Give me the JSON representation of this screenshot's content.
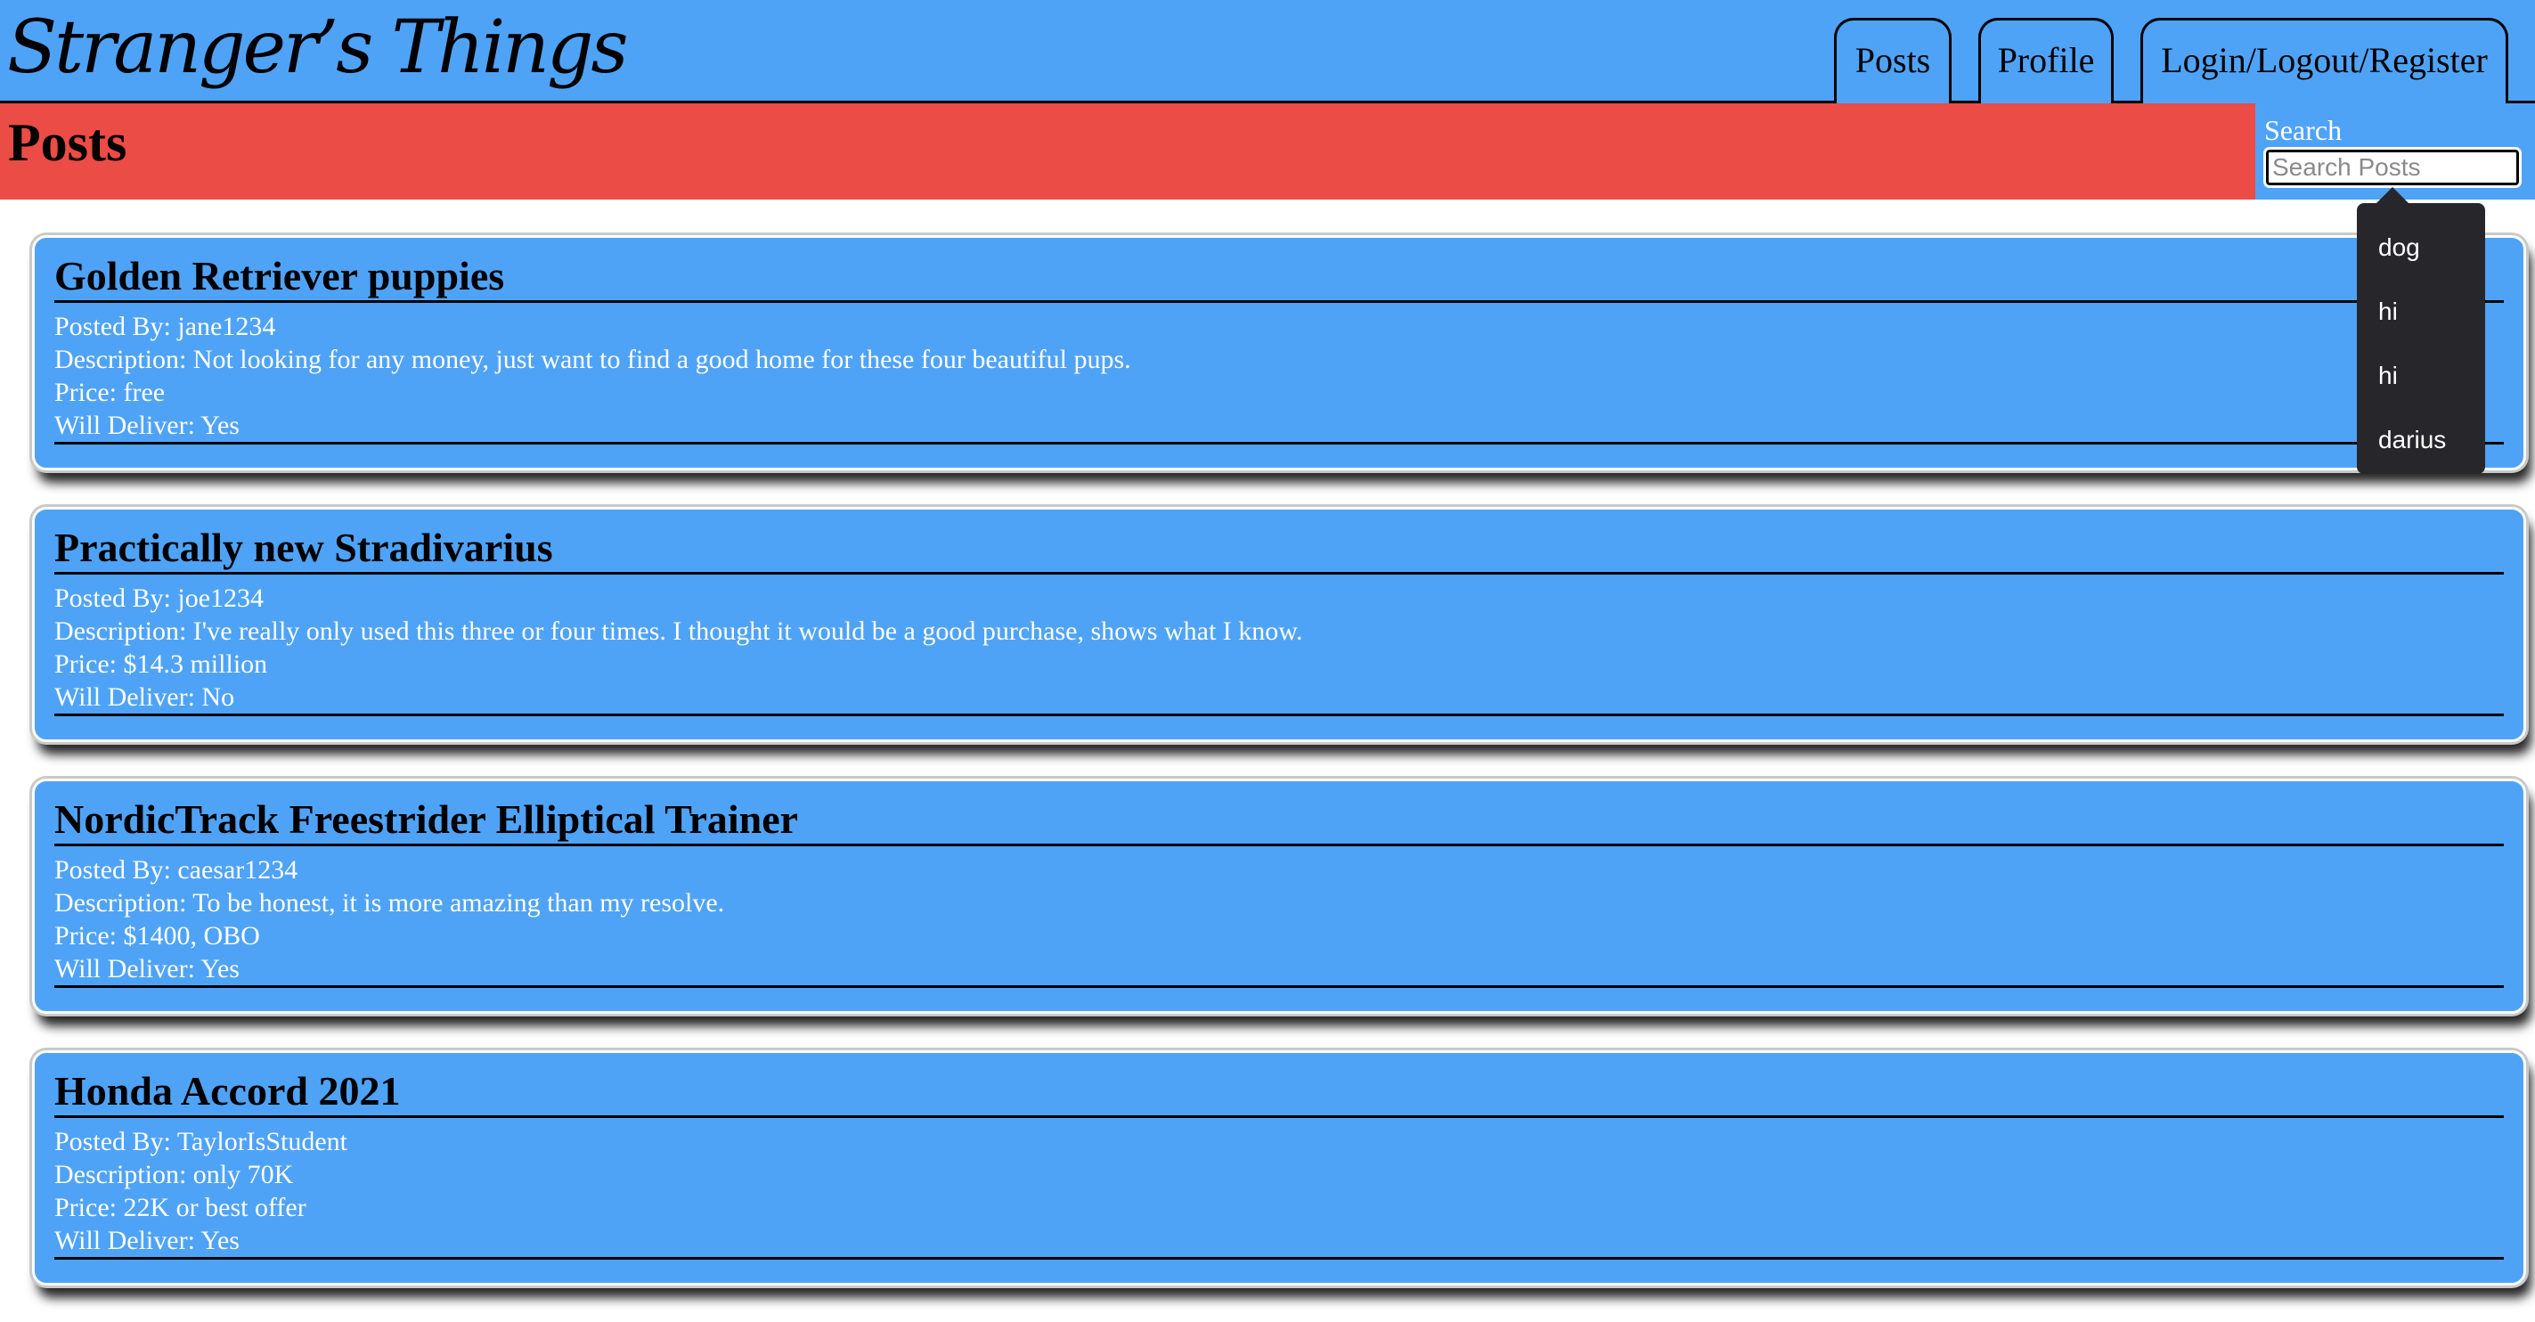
{
  "header": {
    "app_title": "Stranger’s Things",
    "nav": [
      {
        "label": "Posts"
      },
      {
        "label": "Profile"
      },
      {
        "label": "Login/Logout/Register"
      }
    ]
  },
  "page": {
    "title": "Posts"
  },
  "search": {
    "label": "Search",
    "placeholder": "Search Posts",
    "value": "",
    "suggestions": [
      "dog",
      "hi",
      "hi",
      "darius"
    ]
  },
  "posts": [
    {
      "title": "Golden Retriever puppies",
      "posted_by": "Posted By: jane1234",
      "description": "Description: Not looking for any money, just want to find a good home for these four beautiful pups.",
      "price": "Price: free",
      "will_deliver": "Will Deliver: Yes"
    },
    {
      "title": "Practically new Stradivarius",
      "posted_by": "Posted By: joe1234",
      "description": "Description: I've really only used this three or four times. I thought it would be a good purchase, shows what I know.",
      "price": "Price: $14.3 million",
      "will_deliver": "Will Deliver: No"
    },
    {
      "title": "NordicTrack Freestrider Elliptical Trainer",
      "posted_by": "Posted By: caesar1234",
      "description": "Description: To be honest, it is more amazing than my resolve.",
      "price": "Price: $1400, OBO",
      "will_deliver": "Will Deliver: Yes"
    },
    {
      "title": "Honda Accord 2021",
      "posted_by": "Posted By: TaylorIsStudent",
      "description": "Description: only 70K",
      "price": "Price: 22K or best offer",
      "will_deliver": "Will Deliver: Yes"
    }
  ],
  "colors": {
    "header_blue": "#4fa3f7",
    "title_bar_red": "#eb4c45",
    "dropdown_dark": "#27272b"
  }
}
